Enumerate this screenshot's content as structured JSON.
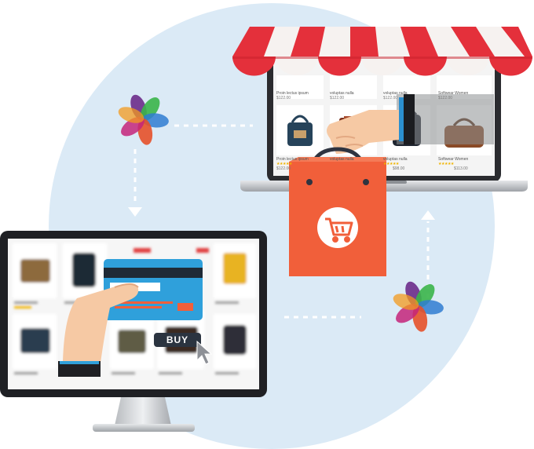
{
  "buy_button": {
    "label": "BUY"
  },
  "laptop_products": [
    {
      "caption": "Proin lectus ipsum",
      "price": "$122.00",
      "stars": "★★★★★"
    },
    {
      "caption": "voluptas nulla",
      "price": "$122.00",
      "stars": "★★★★★"
    },
    {
      "caption": "voluptas nulla",
      "price": "$122.00",
      "stars": "★★★★★"
    },
    {
      "caption": "Softwear Women",
      "price": "$122.00",
      "stars": "★★★★★"
    },
    {
      "caption": "Proin lectus ipsum",
      "price": "$122.00",
      "stars": "★★★★★"
    },
    {
      "caption": "voluptas nulla",
      "price": "$98.00",
      "stars": "★★★★★"
    },
    {
      "caption": "voluptas nulla",
      "price": "$98.00",
      "stars": "★★★★★"
    },
    {
      "caption": "Softwear Women",
      "price": "$113.00",
      "stars": "★★★★★"
    }
  ],
  "colors": {
    "background_circle": "#dbeaf6",
    "awning_red": "#e4303b",
    "shopping_bag": "#f15f3a",
    "credit_card": "#2fa0db",
    "skin": "#f6c9a4",
    "logo_petals": [
      "#6c2c8b",
      "#2f7dd1",
      "#3ab54a",
      "#e5512a",
      "#c4247a"
    ]
  },
  "icons": [
    "storefront-awning-icon",
    "shopping-bag-icon",
    "shopping-cart-icon",
    "credit-card-icon",
    "cursor-icon",
    "flower-logo-icon",
    "dashed-arrow-icon"
  ]
}
